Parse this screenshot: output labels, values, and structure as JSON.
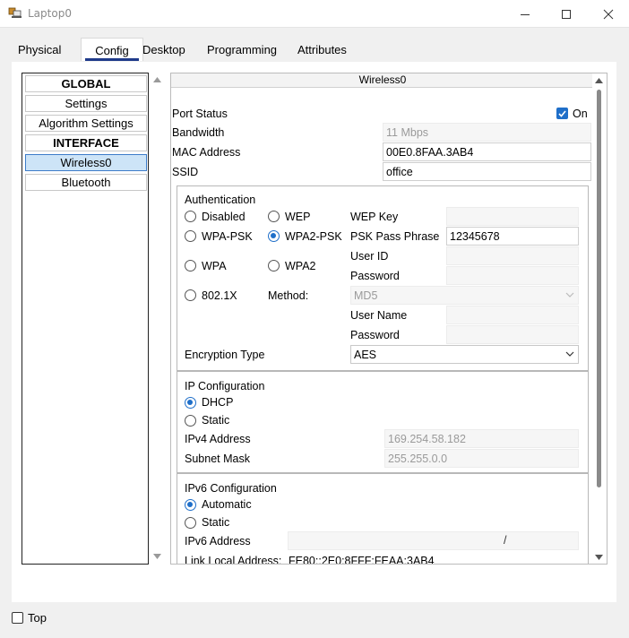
{
  "window": {
    "title": "Laptop0"
  },
  "tabs": [
    {
      "label": "Physical"
    },
    {
      "label": "Config"
    },
    {
      "label": "Desktop"
    },
    {
      "label": "Programming"
    },
    {
      "label": "Attributes"
    }
  ],
  "left_list": [
    {
      "label": "GLOBAL"
    },
    {
      "label": "Settings"
    },
    {
      "label": "Algorithm Settings"
    },
    {
      "label": "INTERFACE"
    },
    {
      "label": "Wireless0"
    },
    {
      "label": "Bluetooth"
    }
  ],
  "panel": {
    "title": "Wireless0",
    "port_status": {
      "label": "Port Status",
      "checkbox_label": "On"
    },
    "bandwidth": {
      "label": "Bandwidth",
      "value": "11 Mbps"
    },
    "mac": {
      "label": "MAC Address",
      "value": "00E0.8FAA.3AB4"
    },
    "ssid": {
      "label": "SSID",
      "value": "office"
    }
  },
  "auth": {
    "title": "Authentication",
    "disabled": "Disabled",
    "wep": "WEP",
    "wpa_psk": "WPA-PSK",
    "wpa2_psk": "WPA2-PSK",
    "wpa": "WPA",
    "wpa2": "WPA2",
    "dot1x": "802.1X",
    "method_label": "Method:",
    "method_value": "MD5",
    "wep_key_label": "WEP Key",
    "psk_label": "PSK Pass Phrase",
    "psk_value": "12345678",
    "user_id_label": "User ID",
    "password_label": "Password",
    "user_name_label": "User Name",
    "password2_label": "Password",
    "enc_label": "Encryption Type",
    "enc_value": "AES"
  },
  "ip": {
    "title": "IP Configuration",
    "dhcp": "DHCP",
    "static": "Static",
    "ipv4_label": "IPv4 Address",
    "ipv4_value": "169.254.58.182",
    "mask_label": "Subnet Mask",
    "mask_value": "255.255.0.0"
  },
  "ipv6": {
    "title": "IPv6 Configuration",
    "automatic": "Automatic",
    "static": "Static",
    "addr_label": "IPv6 Address",
    "prefix_sep": "/",
    "link_local_label": "Link Local Address:",
    "link_local_value": "FE80::2E0:8FFF:FEAA:3AB4"
  },
  "footer": {
    "top_label": "Top"
  },
  "colors": {
    "accent": "#1f6fc9",
    "tab_underline": "#1f3a8a",
    "selected_bg": "#cde4f7"
  }
}
